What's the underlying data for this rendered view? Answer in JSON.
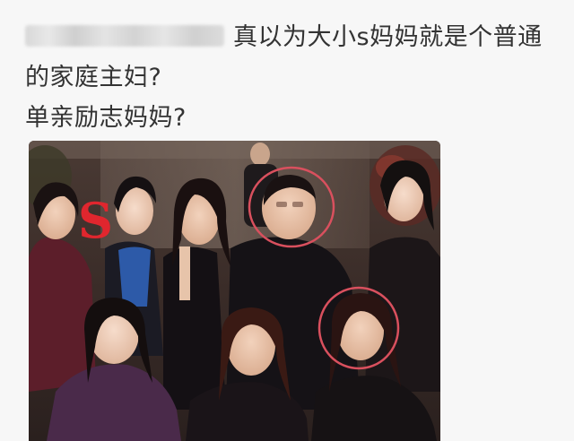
{
  "post": {
    "username": "",
    "text_line1": "真以为大小s妈妈就是个普通",
    "text_line2": "的家庭主妇?",
    "text_line3": "单亲励志妈妈?",
    "highlight_color": "#d9505e"
  },
  "photo": {
    "sign_letter": "S",
    "highlight_color": "#d9505e"
  }
}
